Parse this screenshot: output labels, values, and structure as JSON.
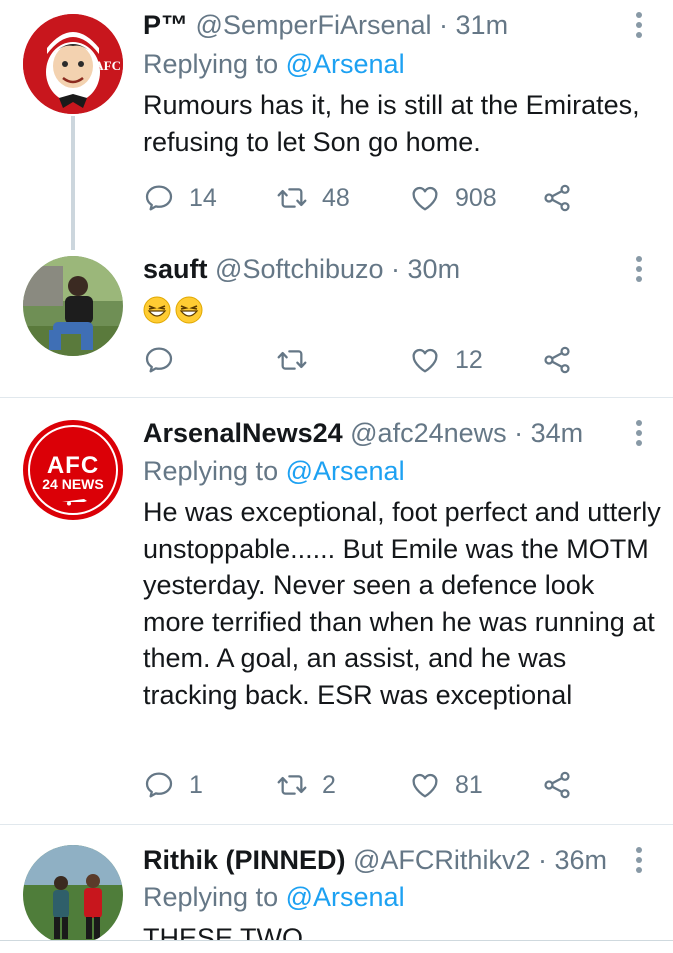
{
  "tweets": [
    {
      "name": "P™",
      "handle": "@SemperFiArsenal",
      "time": "· 31m",
      "replying_prefix": "Replying to",
      "replying_to": "@Arsenal",
      "text": "Rumours has it, he is still at the Emirates, refusing to let Son go home.",
      "replies": "14",
      "retweets": "48",
      "likes": "908",
      "avatar_badge": "AFC"
    },
    {
      "name": "sauft",
      "handle": "@Softchibuzo",
      "time": "· 30m",
      "emoji_count": 2,
      "replies": "",
      "retweets": "",
      "likes": "12"
    },
    {
      "name": "ArsenalNews24",
      "handle": "@afc24news",
      "time": "· 34m",
      "replying_prefix": "Replying to",
      "replying_to": "@Arsenal",
      "text": "He was exceptional, foot perfect and utterly unstoppable...... But Emile was the MOTM yesterday. Never seen a defence look more terrified than when he was running at them. A goal, an assist, and he was tracking back. ESR was exceptional",
      "replies": "1",
      "retweets": "2",
      "likes": "81",
      "avatar_line1": "AFC",
      "avatar_line2": "24 NEWS"
    },
    {
      "name": "Rithik (PINNED)",
      "handle": "@AFCRithikv2",
      "time": "· 36m",
      "replying_prefix": "Replying to",
      "replying_to": "@Arsenal",
      "text": "THESE TWO"
    }
  ],
  "colors": {
    "accent": "#1da1f2",
    "muted": "#657786",
    "text": "#14171a",
    "divider": "#e1e8ed",
    "afc_red": "#db0007"
  },
  "icons": [
    "reply-icon",
    "retweet-icon",
    "like-icon",
    "share-icon",
    "more-icon"
  ]
}
